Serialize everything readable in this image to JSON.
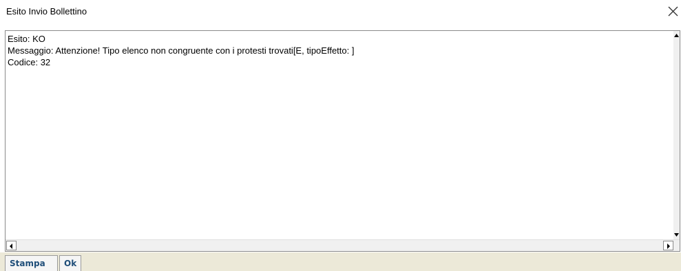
{
  "window": {
    "title": "Esito Invio Bollettino"
  },
  "message": {
    "lines": [
      "Esito: KO",
      "Messaggio: Attenzione! Tipo elenco non congruente con i protesti trovati[E, tipoEffetto: ]",
      "Codice: 32"
    ]
  },
  "toolbar": {
    "stampa_label": "Stampa",
    "ok_label": "Ok"
  },
  "icons": {
    "close": "close-icon",
    "scroll_up": "arrow-up-icon",
    "scroll_down": "arrow-down-icon",
    "scroll_left": "arrow-left-icon",
    "scroll_right": "arrow-right-icon"
  },
  "colors": {
    "button_text": "#1f4e79",
    "toolbar_bg": "#ece9d8",
    "border": "#8a8a8a"
  }
}
